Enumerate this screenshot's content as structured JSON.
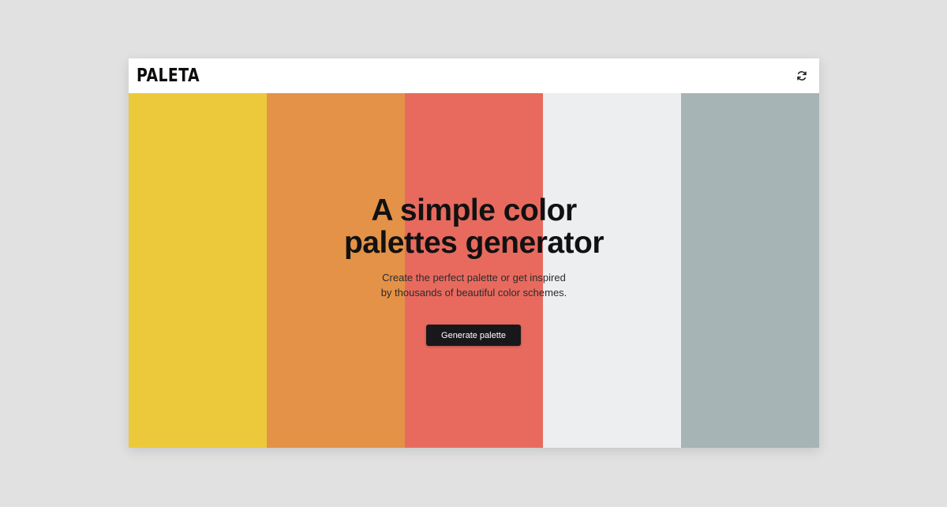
{
  "header": {
    "logo_text": "PALETA",
    "refresh_icon": "refresh-icon"
  },
  "palette": {
    "colors": [
      "#ecc93a",
      "#e39247",
      "#e86a5e",
      "#eceef0",
      "#a7b4b5"
    ]
  },
  "hero": {
    "title_line1": "A simple color",
    "title_line2": "palettes generator",
    "subtitle_line1": "Create the perfect palette or get inspired",
    "subtitle_line2": "by thousands of beautiful color schemes.",
    "cta_label": "Generate palette"
  }
}
